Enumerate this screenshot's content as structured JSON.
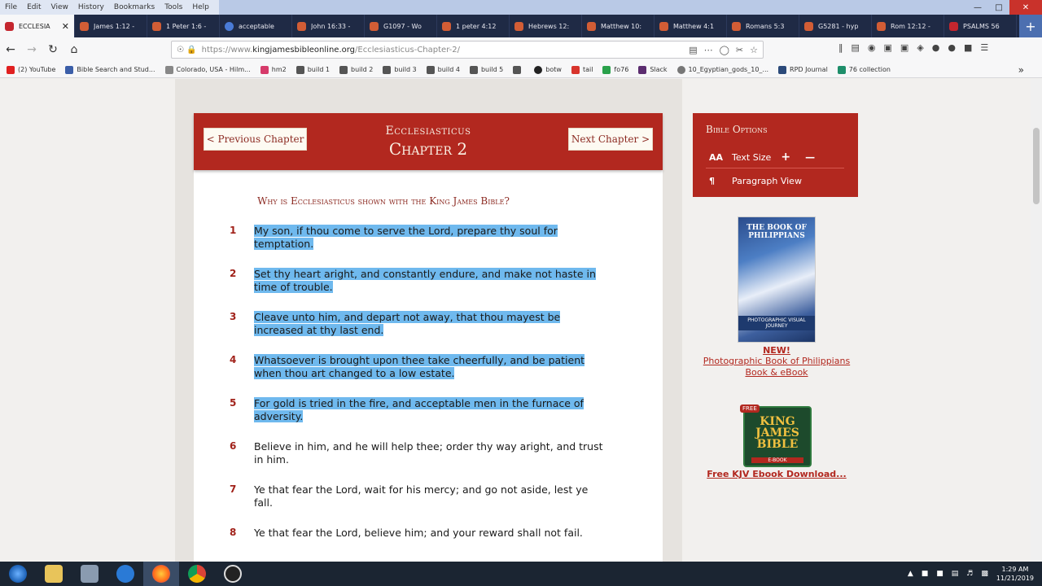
{
  "menubar": {
    "items": [
      "File",
      "Edit",
      "View",
      "History",
      "Bookmarks",
      "Tools",
      "Help"
    ]
  },
  "tabs": [
    {
      "label": "ECCLESIA",
      "active": true
    },
    {
      "label": "James 1:12 -"
    },
    {
      "label": "1 Peter 1:6 -"
    },
    {
      "label": "acceptable"
    },
    {
      "label": "John 16:33 -"
    },
    {
      "label": "G1097 - Wo"
    },
    {
      "label": "1 peter 4:12"
    },
    {
      "label": "Hebrews 12:"
    },
    {
      "label": "Matthew 10:"
    },
    {
      "label": "Matthew 4:1"
    },
    {
      "label": "Romans 5:3"
    },
    {
      "label": "G5281 - hyp"
    },
    {
      "label": "Rom 12:12 -"
    },
    {
      "label": "PSALMS 56"
    }
  ],
  "url": {
    "prefix": "https://www.",
    "domain": "kingjamesbibleonline.org",
    "path": "/Ecclesiasticus-Chapter-2/"
  },
  "bookmarks": [
    "(2) YouTube",
    "Bible Search and Stud...",
    "Colorado, USA - Hilm...",
    "hm2",
    "build 1",
    "build 2",
    "build 3",
    "build 4",
    "build 5",
    "",
    "botw",
    "tail",
    "fo76",
    "Slack",
    "10_Egyptian_gods_10_...",
    "RPD Journal",
    "76 collection"
  ],
  "header": {
    "prev_label": "< Previous Chapter",
    "next_label": "Next Chapter >",
    "book": "Ecclesiasticus",
    "chapter": "Chapter 2"
  },
  "why_link": "Why is Ecclesiasticus shown with the King James Bible?",
  "verses": [
    {
      "num": "1",
      "lines": [
        "My son, if thou come to serve the Lord, prepare thy soul for",
        "temptation."
      ]
    },
    {
      "num": "2",
      "lines": [
        "Set thy heart aright, and constantly endure, and make not haste in",
        "time of trouble."
      ]
    },
    {
      "num": "3",
      "lines": [
        "Cleave unto him, and depart not away, that thou mayest be",
        "increased at thy last end."
      ]
    },
    {
      "num": "4",
      "lines": [
        "Whatsoever is brought upon thee take cheerfully, and be patient",
        "when thou art changed to a low estate."
      ]
    },
    {
      "num": "5",
      "lines": [
        "For gold is tried in the fire, and acceptable men in the furnace of",
        "adversity."
      ]
    },
    {
      "num": "6",
      "lines": [
        "Believe in him, and he will help thee; order thy way aright, and trust",
        "in him."
      ]
    },
    {
      "num": "7",
      "lines": [
        "Ye that fear the Lord, wait for his mercy; and go not aside, lest ye",
        "fall."
      ]
    },
    {
      "num": "8",
      "lines": [
        "Ye that fear the Lord, believe him; and your reward shall not fail."
      ]
    }
  ],
  "options": {
    "title": "Bible Options",
    "text_size_icon": "AA",
    "text_size_label": "Text Size",
    "plus": "+",
    "minus": "—",
    "paragraph_icon": "¶",
    "paragraph_label": "Paragraph View"
  },
  "promo1": {
    "cover_title": "THE BOOK OF PHILIPPIANS",
    "cover_sub": "PHOTOGRAPHIC VISUAL JOURNEY",
    "new_label": "NEW!",
    "link_line1": "Photographic Book of Philippians",
    "link_line2": "Book & eBook"
  },
  "promo2": {
    "free": "FREE",
    "cover_line1": "KING",
    "cover_line2": "JAMES",
    "cover_line3": "BIBLE",
    "ebook": "E-BOOK",
    "link": "Free KJV Ebook Download..."
  },
  "clock": {
    "time": "1:29 AM",
    "date": "11/21/2019"
  }
}
